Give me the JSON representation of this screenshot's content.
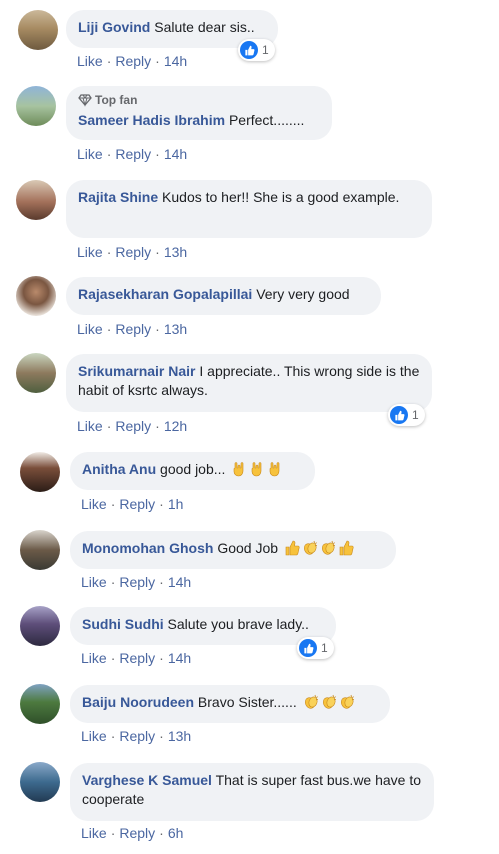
{
  "labels": {
    "like": "Like",
    "reply": "Reply",
    "separator": "·"
  },
  "comments": [
    {
      "author": "Liji Govind",
      "text": "Salute dear sis..",
      "time": "14h",
      "reactions": "1",
      "emoji": []
    },
    {
      "author": "Sameer Hadis Ibrahim",
      "text": "Perfect........",
      "time": "14h",
      "badge": "Top fan",
      "emoji": []
    },
    {
      "author": "Rajita Shine",
      "text": "Kudos to her!! She is a good example.",
      "time": "13h",
      "emoji": []
    },
    {
      "author": "Rajasekharan Gopalapillai",
      "text": "Very very good",
      "time": "13h",
      "emoji": []
    },
    {
      "author": "Srikumarnair Nair",
      "text": "I appreciate.. This wrong side is the habit of ksrtc always.",
      "time": "12h",
      "reactions": "1",
      "emoji": []
    },
    {
      "author": "Anitha Anu",
      "text": "good job...",
      "time": "1h",
      "emoji": [
        "rock-hand-icon",
        "rock-hand-icon",
        "rock-hand-icon"
      ]
    },
    {
      "author": "Monomohan Ghosh",
      "text": "Good Job",
      "time": "14h",
      "emoji": [
        "thumbs-up-icon",
        "clapping-hands-icon",
        "clapping-hands-icon",
        "thumbs-up-icon"
      ]
    },
    {
      "author": "Sudhi Sudhi",
      "text": "Salute you brave lady..",
      "time": "14h",
      "reactions": "1",
      "emoji": []
    },
    {
      "author": "Baiju Noorudeen",
      "text": "Bravo Sister......",
      "time": "13h",
      "emoji": [
        "clapping-hands-icon",
        "clapping-hands-icon",
        "clapping-hands-icon"
      ]
    },
    {
      "author": "Varghese K Samuel",
      "text": "That is super fast bus.we have to cooperate",
      "time": "6h",
      "emoji": []
    }
  ]
}
